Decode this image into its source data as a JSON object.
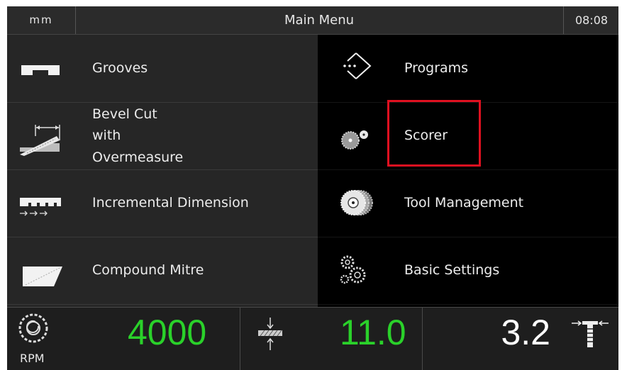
{
  "header": {
    "units": "mm",
    "title": "Main Menu",
    "time": "08:08"
  },
  "menu_left": [
    {
      "lines": [
        "Grooves"
      ],
      "icon": "groove-icon"
    },
    {
      "lines": [
        "Bevel Cut",
        "with",
        "Overmeasure"
      ],
      "icon": "bevel-cut-icon"
    },
    {
      "lines": [
        "Incremental Dimension"
      ],
      "icon": "incremental-dimension-icon"
    },
    {
      "lines": [
        "Compound Mitre"
      ],
      "icon": "compound-mitre-icon"
    }
  ],
  "menu_right": [
    {
      "label": "Programs",
      "icon": "programs-icon"
    },
    {
      "label": "Scorer",
      "icon": "scorer-icon"
    },
    {
      "label": "Tool Management",
      "icon": "tool-management-icon"
    },
    {
      "label": "Basic Settings",
      "icon": "gears-icon"
    }
  ],
  "footer": {
    "rpm_value": "4000",
    "rpm_label": "RPM",
    "thickness_value": "11.0",
    "saw_value": "3.2"
  },
  "colors": {
    "value_green": "#2ad12a",
    "highlight_red": "#e01020",
    "panel": "#262626",
    "active_column": "#000000"
  }
}
